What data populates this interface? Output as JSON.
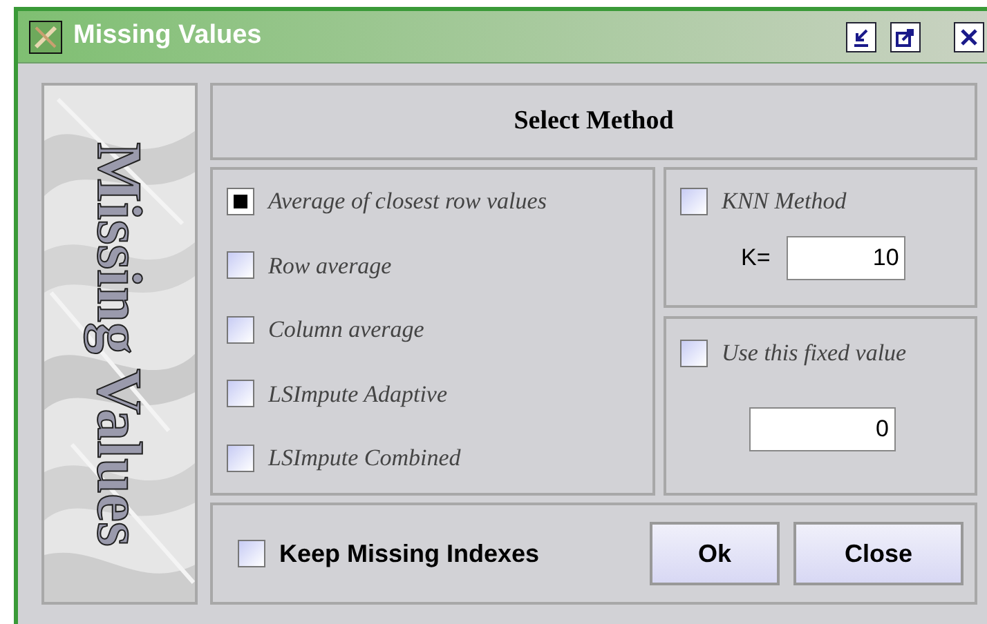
{
  "window": {
    "title": "Missing Values"
  },
  "banner": {
    "text": "Missing Values"
  },
  "header": {
    "title": "Select Method"
  },
  "methods": [
    {
      "label": "Average of closest row values",
      "checked": true
    },
    {
      "label": "Row average",
      "checked": false
    },
    {
      "label": "Column average",
      "checked": false
    },
    {
      "label": "LSImpute Adaptive",
      "checked": false
    },
    {
      "label": "LSImpute Combined",
      "checked": false
    }
  ],
  "knn": {
    "label": "KNN Method",
    "checked": false,
    "k_label": "K=",
    "k_value": "10"
  },
  "fixed": {
    "label": "Use this fixed value",
    "checked": false,
    "value": "0"
  },
  "keep_missing": {
    "label": "Keep Missing Indexes",
    "checked": false
  },
  "buttons": [
    "Ok",
    "Close"
  ]
}
